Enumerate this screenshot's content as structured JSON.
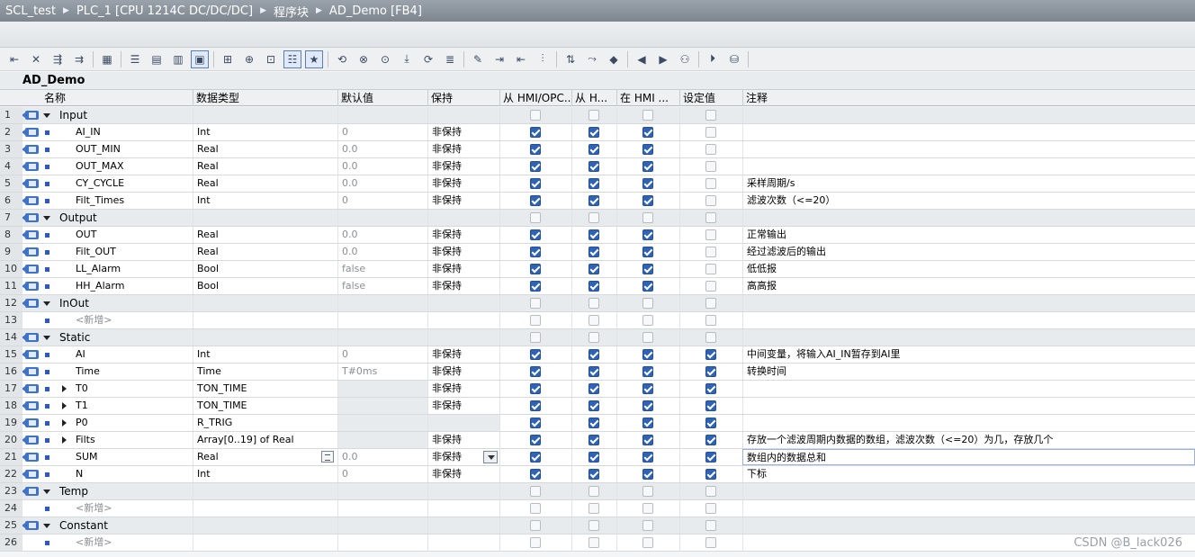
{
  "breadcrumb": [
    "SCL_test",
    "PLC_1 [CPU 1214C DC/DC/DC]",
    "程序块",
    "AD_Demo [FB4]"
  ],
  "block_name": "AD_Demo",
  "columns": {
    "name": "名称",
    "type": "数据类型",
    "default": "默认值",
    "retain": "保持",
    "hmi_opc": "从 HMI/OPC...",
    "hmi_h": "从 H...",
    "in_hmi": "在 HMI ...",
    "setpoint": "设定值",
    "comment": "注释"
  },
  "toolbar_icons": [
    "insert-row-icon",
    "delete-row-icon",
    "insert-snapshot-icon",
    "copy-snapshot-icon",
    "monitoring-icon",
    "expand-all-icon",
    "block-interface-icon",
    "collapse-icon",
    "comments-icon",
    "insert-network-icon",
    "add-icon",
    "navigate-icon",
    "list-view-icon",
    "favorites-icon",
    "go-to-icon",
    "clear-icon",
    "monitor-icon",
    "download-icon",
    "call-icon",
    "tree-icon",
    "edit-icon",
    "indent-icon",
    "unindent-icon",
    "align-icon",
    "sort-icon",
    "jump-icon",
    "bookmark-icon",
    "prev-bookmark-icon",
    "next-bookmark-icon",
    "cross-ref-icon",
    "step-icon",
    "memory-icon"
  ],
  "rows": [
    {
      "num": "1",
      "kind": "section",
      "name": "Input",
      "expand": "open",
      "h1": false,
      "h2": false,
      "h3": false,
      "set": false
    },
    {
      "num": "2",
      "kind": "var",
      "name": "AI_IN",
      "type": "Int",
      "default": "0",
      "retain": "非保持",
      "h1": true,
      "h2": true,
      "h3": true,
      "set": false,
      "comment": ""
    },
    {
      "num": "3",
      "kind": "var",
      "name": "OUT_MIN",
      "type": "Real",
      "default": "0.0",
      "retain": "非保持",
      "h1": true,
      "h2": true,
      "h3": true,
      "set": false,
      "comment": ""
    },
    {
      "num": "4",
      "kind": "var",
      "name": "OUT_MAX",
      "type": "Real",
      "default": "0.0",
      "retain": "非保持",
      "h1": true,
      "h2": true,
      "h3": true,
      "set": false,
      "comment": ""
    },
    {
      "num": "5",
      "kind": "var",
      "name": "CY_CYCLE",
      "type": "Real",
      "default": "0.0",
      "retain": "非保持",
      "h1": true,
      "h2": true,
      "h3": true,
      "set": false,
      "comment": "采样周期/s"
    },
    {
      "num": "6",
      "kind": "var",
      "name": "Filt_Times",
      "type": "Int",
      "default": "0",
      "retain": "非保持",
      "h1": true,
      "h2": true,
      "h3": true,
      "set": false,
      "comment": "滤波次数（<=20）"
    },
    {
      "num": "7",
      "kind": "section",
      "name": "Output",
      "expand": "open",
      "h1": false,
      "h2": false,
      "h3": false,
      "set": false
    },
    {
      "num": "8",
      "kind": "var",
      "name": "OUT",
      "type": "Real",
      "default": "0.0",
      "retain": "非保持",
      "h1": true,
      "h2": true,
      "h3": true,
      "set": false,
      "comment": "正常输出"
    },
    {
      "num": "9",
      "kind": "var",
      "name": "Filt_OUT",
      "type": "Real",
      "default": "0.0",
      "retain": "非保持",
      "h1": true,
      "h2": true,
      "h3": true,
      "set": false,
      "comment": "经过滤波后的输出"
    },
    {
      "num": "10",
      "kind": "var",
      "name": "LL_Alarm",
      "type": "Bool",
      "default": "false",
      "retain": "非保持",
      "h1": true,
      "h2": true,
      "h3": true,
      "set": false,
      "comment": "低低报"
    },
    {
      "num": "11",
      "kind": "var",
      "name": "HH_Alarm",
      "type": "Bool",
      "default": "false",
      "retain": "非保持",
      "h1": true,
      "h2": true,
      "h3": true,
      "set": false,
      "comment": "高高报"
    },
    {
      "num": "12",
      "kind": "section",
      "name": "InOut",
      "expand": "open",
      "h1": false,
      "h2": false,
      "h3": false,
      "set": false
    },
    {
      "num": "13",
      "kind": "add",
      "name": "<新增>",
      "h1": false,
      "h2": false,
      "h3": false,
      "set": false
    },
    {
      "num": "14",
      "kind": "section",
      "name": "Static",
      "expand": "open",
      "h1": false,
      "h2": false,
      "h3": false,
      "set": false
    },
    {
      "num": "15",
      "kind": "var",
      "name": "AI",
      "type": "Int",
      "default": "0",
      "retain": "非保持",
      "h1": true,
      "h2": true,
      "h3": true,
      "set": true,
      "comment": "中间变量，将输入AI_IN暂存到AI里"
    },
    {
      "num": "16",
      "kind": "var",
      "name": "Time",
      "type": "Time",
      "default": "T#0ms",
      "retain": "非保持",
      "h1": true,
      "h2": true,
      "h3": true,
      "set": true,
      "comment": "转换时间"
    },
    {
      "num": "17",
      "kind": "struct",
      "name": "T0",
      "type": "TON_TIME",
      "default": "",
      "retain": "非保持",
      "h1": true,
      "h2": true,
      "h3": true,
      "set": true,
      "comment": ""
    },
    {
      "num": "18",
      "kind": "struct",
      "name": "T1",
      "type": "TON_TIME",
      "default": "",
      "retain": "非保持",
      "h1": true,
      "h2": true,
      "h3": true,
      "set": true,
      "comment": ""
    },
    {
      "num": "19",
      "kind": "struct",
      "name": "P0",
      "type": "R_TRIG",
      "default": "",
      "retain": "",
      "h1": true,
      "h2": true,
      "h3": true,
      "set": true,
      "comment": ""
    },
    {
      "num": "20",
      "kind": "struct",
      "name": "Filts",
      "type": "Array[0..19] of Real",
      "default": "",
      "retain": "非保持",
      "h1": true,
      "h2": true,
      "h3": true,
      "set": true,
      "comment": "存放一个滤波周期内数据的数组，滤波次数（<=20）为几，存放几个"
    },
    {
      "num": "21",
      "kind": "var",
      "name": "SUM",
      "type": "Real",
      "default": "0.0",
      "retain": "非保持",
      "h1": true,
      "h2": true,
      "h3": true,
      "set": true,
      "comment": "数组内的数据总和",
      "editing": true
    },
    {
      "num": "22",
      "kind": "var",
      "name": "N",
      "type": "Int",
      "default": "0",
      "retain": "非保持",
      "h1": true,
      "h2": true,
      "h3": true,
      "set": true,
      "comment": "下标"
    },
    {
      "num": "23",
      "kind": "section",
      "name": "Temp",
      "expand": "open",
      "h1": false,
      "h2": false,
      "h3": false,
      "set": false
    },
    {
      "num": "24",
      "kind": "add",
      "name": "<新增>",
      "h1": false,
      "h2": false,
      "h3": false,
      "set": false
    },
    {
      "num": "25",
      "kind": "section",
      "name": "Constant",
      "expand": "open",
      "h1": false,
      "h2": false,
      "h3": false,
      "set": false
    },
    {
      "num": "26",
      "kind": "add",
      "name": "<新增>",
      "h1": false,
      "h2": false,
      "h3": false,
      "set": false
    }
  ],
  "watermark": "CSDN @B_lack026"
}
